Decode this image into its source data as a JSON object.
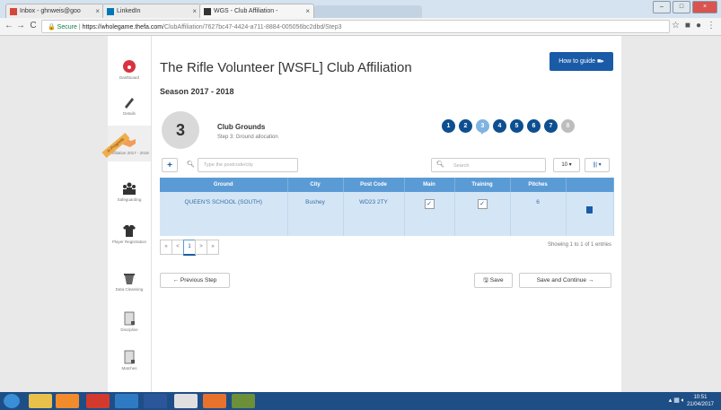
{
  "browser": {
    "tabs": [
      {
        "label": "Inbox - ghnweis@goo"
      },
      {
        "label": "LinkedIn"
      },
      {
        "label": "WGS - Club Affiliation -"
      }
    ],
    "address_secure": "Secure",
    "address_host": "https://wholegame.thefa.com",
    "address_path": "/ClubAffiliation/7627bc47-4424-a711-8884-005056bc2dbd/Step3"
  },
  "sidebar": {
    "items": [
      {
        "label": "Dashboard"
      },
      {
        "label": "Details"
      },
      {
        "label": "Affiliation 2017 - 2018"
      },
      {
        "label": "Safeguarding"
      },
      {
        "label": "Player Registration"
      },
      {
        "label": "Data Cleansing"
      },
      {
        "label": "Discipline"
      },
      {
        "label": "Matches"
      }
    ],
    "ribbon": "In Progress"
  },
  "page": {
    "title": "The Rifle Volunteer [WSFL] Club Affiliation",
    "howto": "How to guide",
    "season": "Season 2017 - 2018",
    "step_number": "3",
    "step_title": "Club Grounds",
    "step_subtitle": "Step 3: Ground allocation",
    "steps": [
      "1",
      "2",
      "3",
      "4",
      "5",
      "6",
      "7",
      "8"
    ]
  },
  "toolbar": {
    "add": "+",
    "postcode_placeholder": "Type the postcode/city",
    "search_placeholder": "Search",
    "page_size": "10",
    "columns": "|||"
  },
  "table": {
    "headers": [
      "Ground",
      "City",
      "Post Code",
      "Main",
      "Training",
      "Pitches",
      ""
    ],
    "row": {
      "ground": "QUEEN'S SCHOOL (SOUTH)",
      "city": "Bushey",
      "postcode": "WD23 2TY",
      "main": true,
      "training": true,
      "pitches": "6"
    }
  },
  "pager": {
    "first": "«",
    "prev": "<",
    "current": "1",
    "next": ">",
    "last": "»",
    "showing": "Showing 1 to 1 of 1 entries"
  },
  "buttons": {
    "previous": "← Previous Step",
    "save": "Save",
    "save_continue": "Save and Continue →"
  },
  "taskbar": {
    "time": "10:51",
    "date": "21/04/2017"
  },
  "colors": {
    "primary": "#1a5ba8",
    "step_dark": "#0d4f91",
    "step_current": "#7fb3e2",
    "table_header": "#5b9bd5",
    "table_row": "#d4e6f6"
  }
}
